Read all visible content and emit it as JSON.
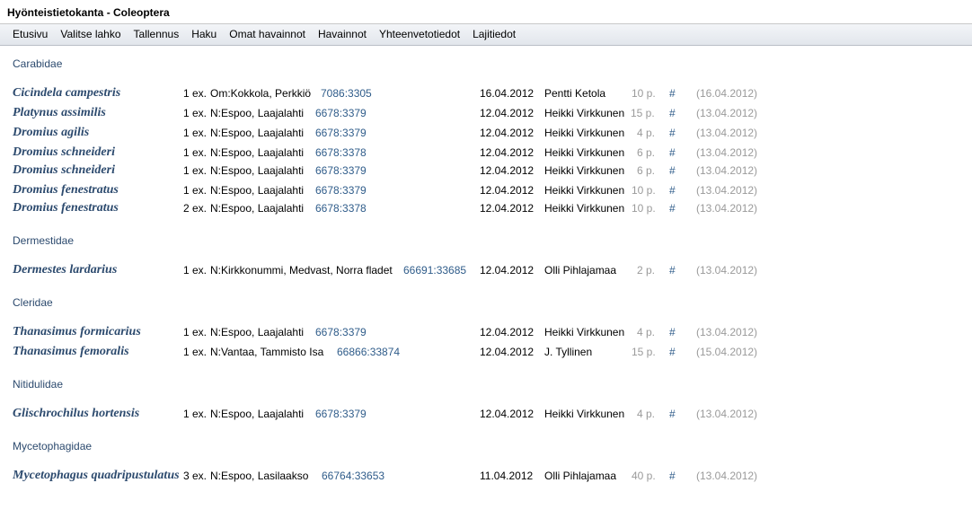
{
  "window": {
    "title": "Hyönteistietokanta - Coleoptera"
  },
  "menu": [
    "Etusivu",
    "Valitse lahko",
    "Tallennus",
    "Haku",
    "Omat havainnot",
    "Havainnot",
    "Yhteenvetotiedot",
    "Lajitiedot"
  ],
  "families": [
    {
      "name": "Carabidae",
      "rows": [
        {
          "species": "Cicindela campestris",
          "count": "1 ex.",
          "locality": "Om:Kokkola, Perkkiö",
          "coord": "7086:3305",
          "date": "16.04.2012",
          "observer": "Pentti Ketola",
          "points": "10 p.",
          "hash": "#",
          "recorded": "(16.04.2012)"
        },
        {
          "species": "Platynus assimilis",
          "count": "1 ex.",
          "locality": "N:Espoo, Laajalahti",
          "coord": "6678:3379",
          "date": "12.04.2012",
          "observer": "Heikki Virkkunen",
          "points": "15 p.",
          "hash": "#",
          "recorded": "(13.04.2012)"
        },
        {
          "species": "Dromius agilis",
          "count": "1 ex.",
          "locality": "N:Espoo, Laajalahti",
          "coord": "6678:3379",
          "date": "12.04.2012",
          "observer": "Heikki Virkkunen",
          "points": "4 p.",
          "hash": "#",
          "recorded": "(13.04.2012)"
        },
        {
          "species": "Dromius schneideri",
          "count": "1 ex.",
          "locality": "N:Espoo, Laajalahti",
          "coord": "6678:3378",
          "date": "12.04.2012",
          "observer": "Heikki Virkkunen",
          "points": "6 p.",
          "hash": "#",
          "recorded": "(13.04.2012)"
        },
        {
          "species": "Dromius schneideri",
          "count": "1 ex.",
          "locality": "N:Espoo, Laajalahti",
          "coord": "6678:3379",
          "date": "12.04.2012",
          "observer": "Heikki Virkkunen",
          "points": "6 p.",
          "hash": "#",
          "recorded": "(13.04.2012)"
        },
        {
          "species": "Dromius fenestratus",
          "count": "1 ex.",
          "locality": "N:Espoo, Laajalahti",
          "coord": "6678:3379",
          "date": "12.04.2012",
          "observer": "Heikki Virkkunen",
          "points": "10 p.",
          "hash": "#",
          "recorded": "(13.04.2012)"
        },
        {
          "species": "Dromius fenestratus",
          "count": "2 ex.",
          "locality": "N:Espoo, Laajalahti",
          "coord": "6678:3378",
          "date": "12.04.2012",
          "observer": "Heikki Virkkunen",
          "points": "10 p.",
          "hash": "#",
          "recorded": "(13.04.2012)"
        }
      ]
    },
    {
      "name": "Dermestidae",
      "rows": [
        {
          "species": "Dermestes lardarius",
          "count": "1 ex.",
          "locality": "N:Kirkkonummi, Medvast, Norra fladet",
          "coord": "66691:33685",
          "date": "12.04.2012",
          "observer": "Olli Pihlajamaa",
          "points": "2 p.",
          "hash": "#",
          "recorded": "(13.04.2012)"
        }
      ]
    },
    {
      "name": "Cleridae",
      "rows": [
        {
          "species": "Thanasimus formicarius",
          "count": "1 ex.",
          "locality": "N:Espoo, Laajalahti",
          "coord": "6678:3379",
          "date": "12.04.2012",
          "observer": "Heikki Virkkunen",
          "points": "4 p.",
          "hash": "#",
          "recorded": "(13.04.2012)"
        },
        {
          "species": "Thanasimus femoralis",
          "count": "1 ex.",
          "locality": "N:Vantaa, Tammisto Isa",
          "coord": "66866:33874",
          "date": "12.04.2012",
          "observer": "J. Tyllinen",
          "points": "15 p.",
          "hash": "#",
          "recorded": "(15.04.2012)"
        }
      ]
    },
    {
      "name": "Nitidulidae",
      "rows": [
        {
          "species": "Glischrochilus hortensis",
          "count": "1 ex.",
          "locality": "N:Espoo, Laajalahti",
          "coord": "6678:3379",
          "date": "12.04.2012",
          "observer": "Heikki Virkkunen",
          "points": "4 p.",
          "hash": "#",
          "recorded": "(13.04.2012)"
        }
      ]
    },
    {
      "name": "Mycetophagidae",
      "rows": [
        {
          "species": "Mycetophagus quadripustulatus",
          "count": "3 ex.",
          "locality": "N:Espoo, Lasilaakso",
          "coord": "66764:33653",
          "date": "11.04.2012",
          "observer": "Olli Pihlajamaa",
          "points": "40 p.",
          "hash": "#",
          "recorded": "(13.04.2012)"
        }
      ]
    }
  ]
}
